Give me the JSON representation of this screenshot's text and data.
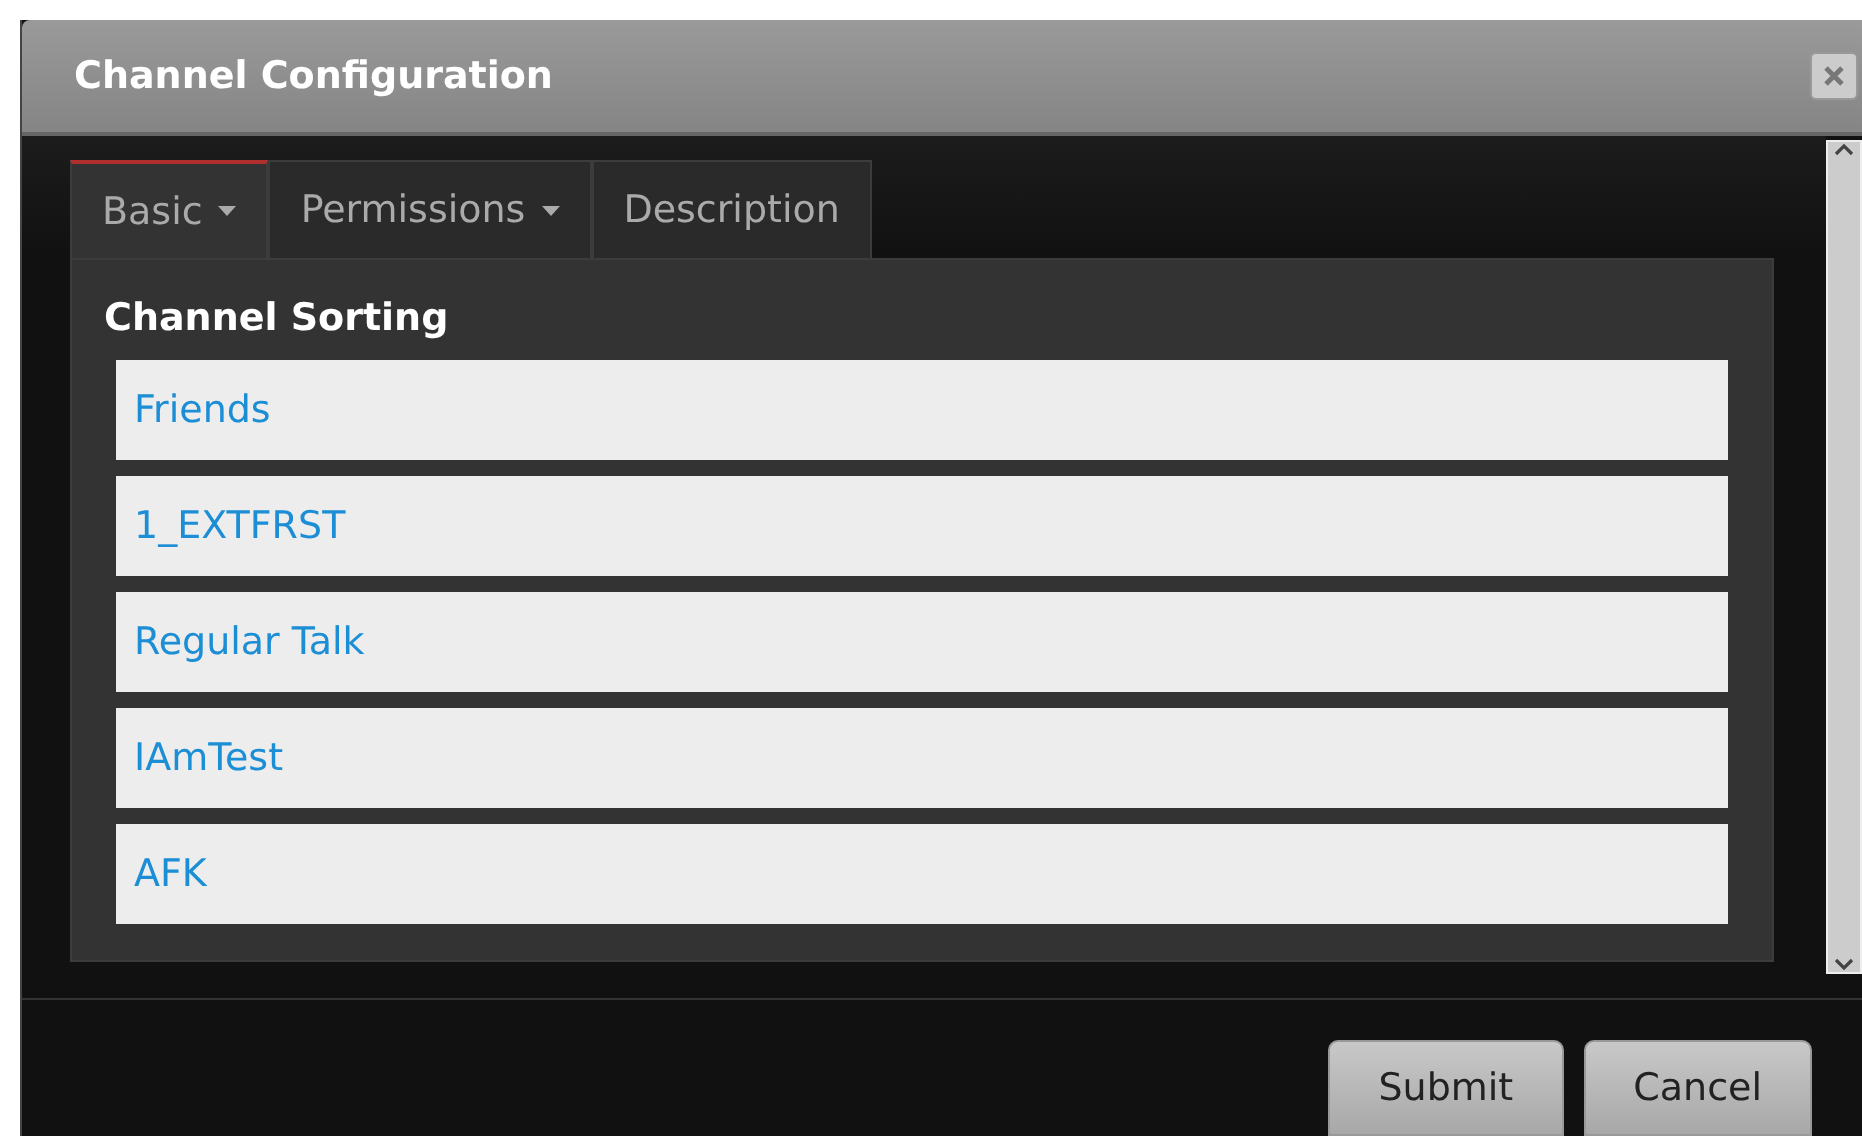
{
  "window": {
    "title": "Channel Configuration"
  },
  "tabs": [
    {
      "label": "Basic",
      "dropdown": true,
      "selected": true
    },
    {
      "label": "Permissions",
      "dropdown": true,
      "selected": false
    },
    {
      "label": "Description",
      "dropdown": false,
      "selected": false
    }
  ],
  "section": {
    "heading": "Channel Sorting"
  },
  "channels": [
    "Friends",
    "1_EXTFRST",
    "Regular Talk",
    "IAmTest",
    "AFK"
  ],
  "buttons": [
    "Submit",
    "Cancel"
  ]
}
